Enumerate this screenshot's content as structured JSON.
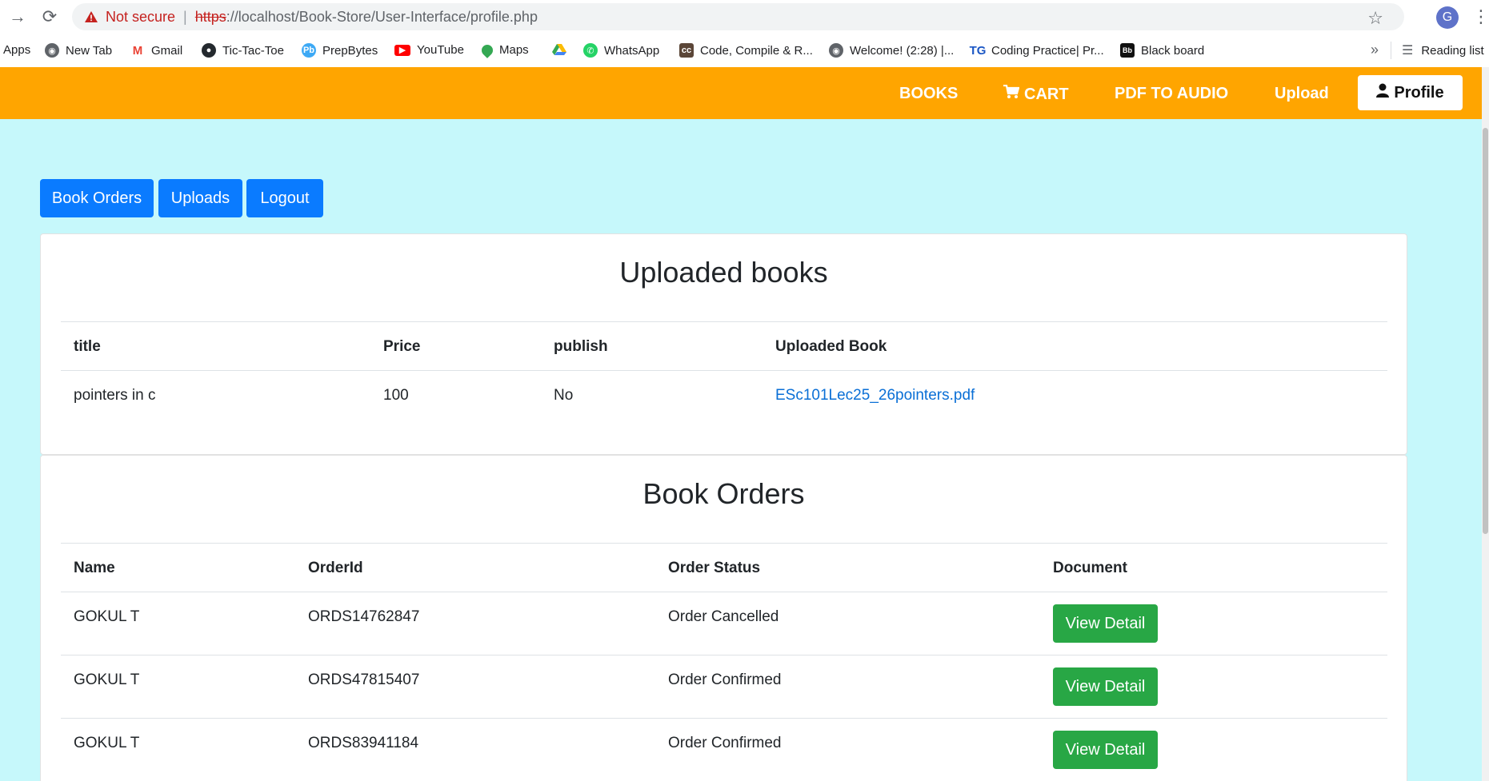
{
  "browser": {
    "security_label": "Not secure",
    "url_protocol": "https",
    "url_rest": "://localhost/Book-Store/User-Interface/profile.php",
    "avatar_letter": "G",
    "bookmarks": [
      "Apps",
      "New Tab",
      "Gmail",
      "Tic-Tac-Toe",
      "PrepBytes",
      "YouTube",
      "Maps",
      "",
      "WhatsApp",
      "Code, Compile & R...",
      "Welcome! (2:28) |...",
      "Coding Practice| Pr...",
      "Black board"
    ],
    "more_label": "»",
    "reading_list": "Reading list"
  },
  "navbar": {
    "color": "#ffa500",
    "links": [
      "BOOKS",
      "CART",
      "PDF TO AUDIO",
      "Upload"
    ],
    "profile": "Profile"
  },
  "actions": [
    "Book Orders",
    "Uploads",
    "Logout"
  ],
  "uploaded": {
    "title": "Uploaded books",
    "headers": [
      "title",
      "Price",
      "publish",
      "Uploaded Book"
    ],
    "rows": [
      {
        "title": "pointers in c",
        "price": "100",
        "publish": "No",
        "file": "ESc101Lec25_26pointers.pdf"
      }
    ]
  },
  "orders": {
    "title": "Book Orders",
    "headers": [
      "Name",
      "OrderId",
      "Order Status",
      "Document"
    ],
    "button_label": "View Detail",
    "rows": [
      {
        "name": "GOKUL T",
        "id": "ORDS14762847",
        "status": "Order Cancelled"
      },
      {
        "name": "GOKUL T",
        "id": "ORDS47815407",
        "status": "Order Confirmed"
      },
      {
        "name": "GOKUL T",
        "id": "ORDS83941184",
        "status": "Order Confirmed"
      }
    ]
  },
  "colors": {
    "page_bg": "#c6f8fb",
    "primary": "#0a7bff",
    "success": "#28a745",
    "link": "#0a6fd6"
  }
}
